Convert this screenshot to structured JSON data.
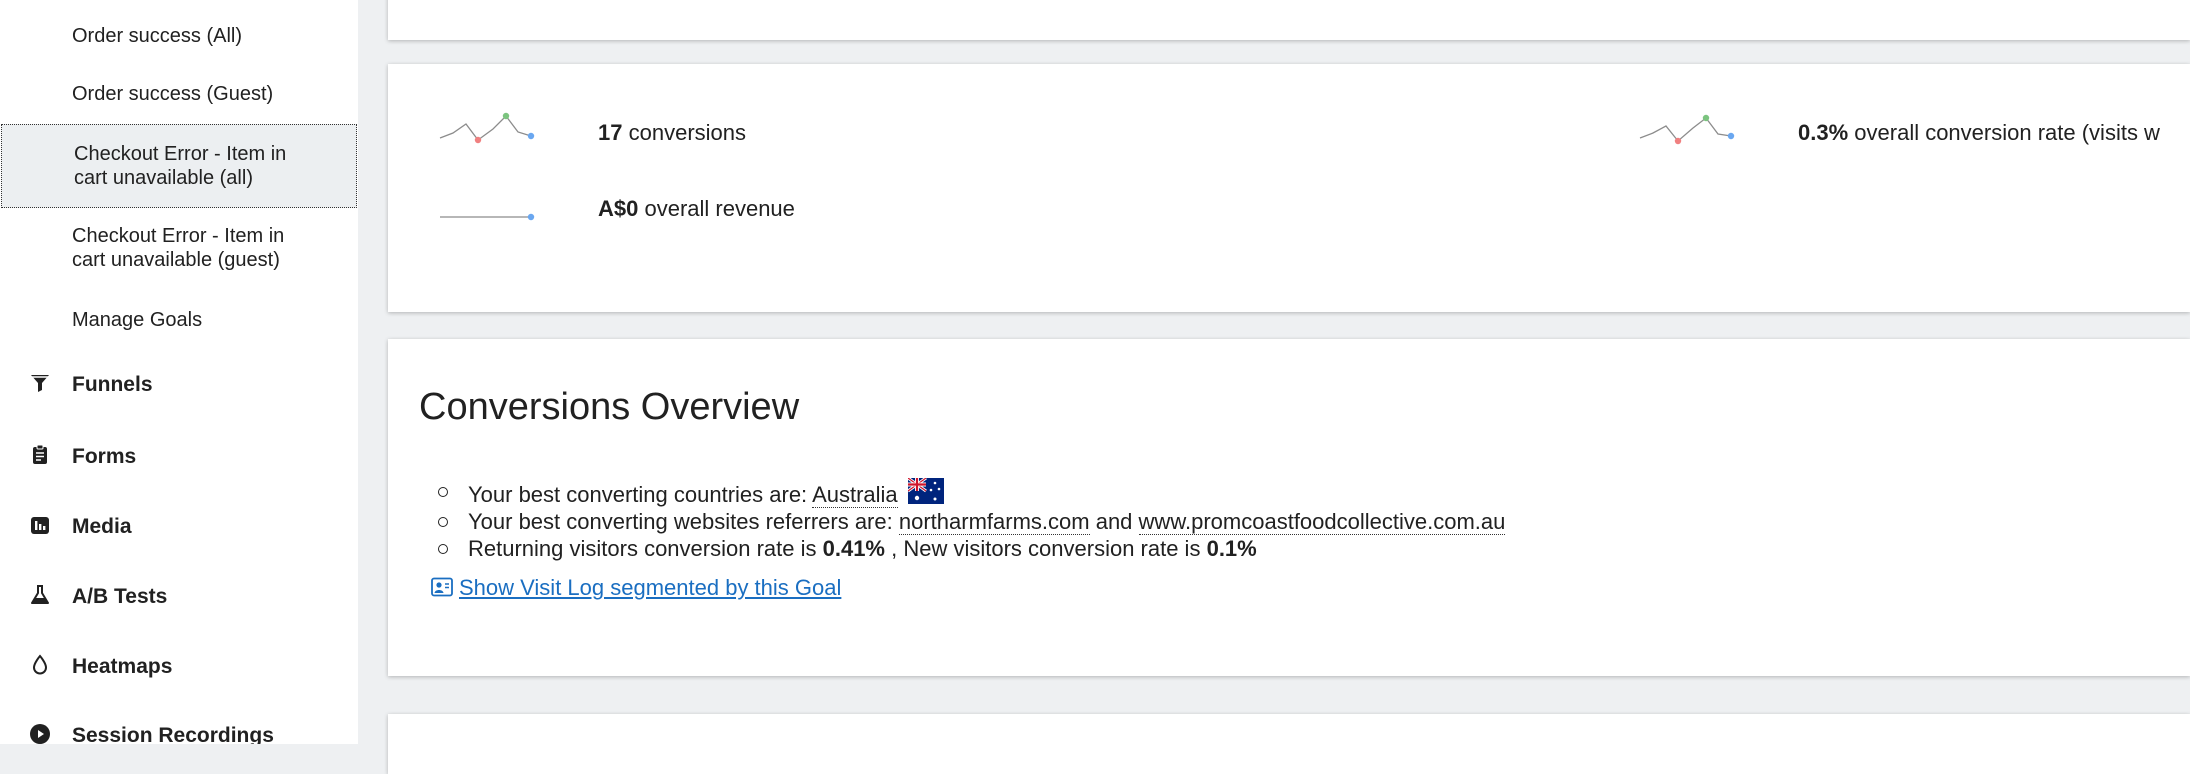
{
  "sidebar": {
    "goals": [
      {
        "label": "Order success (All)"
      },
      {
        "label": "Order success (Guest)"
      },
      {
        "label": "Checkout Error - Item in cart unavailable (all)",
        "line1": "Checkout Error - Item in",
        "line2": "cart unavailable (all)"
      },
      {
        "label": "Checkout Error - Item in cart unavailable (guest)",
        "line1": "Checkout Error - Item in",
        "line2": "cart unavailable (guest)"
      },
      {
        "label": "Manage Goals"
      }
    ],
    "categories": [
      {
        "label": "Funnels",
        "icon": "funnel-icon"
      },
      {
        "label": "Forms",
        "icon": "clipboard-icon"
      },
      {
        "label": "Media",
        "icon": "media-icon"
      },
      {
        "label": "A/B Tests",
        "icon": "flask-icon"
      },
      {
        "label": "Heatmaps",
        "icon": "drop-icon"
      },
      {
        "label": "Session Recordings",
        "icon": "play-icon"
      }
    ]
  },
  "metrics": {
    "conversions": {
      "value": "17",
      "label": "conversions"
    },
    "conversion_rate": {
      "value": "0.3%",
      "label": "overall conversion rate (visits w"
    },
    "revenue": {
      "value": "A$0",
      "label": "overall revenue"
    }
  },
  "overview": {
    "title": "Conversions Overview",
    "countries_prefix": "Your best converting countries are:",
    "country": "Australia",
    "referrers_prefix": "Your best converting websites referrers are:",
    "referrer1": "northarmfarms.com",
    "referrer_and": "and",
    "referrer2": "www.promcoastfoodcollective.com.au",
    "returning_prefix": "Returning visitors conversion rate is",
    "returning_rate": "0.41%",
    "new_prefix": ", New visitors conversion rate is",
    "new_rate": "0.1%",
    "visit_log_link": "Show Visit Log segmented by this Goal"
  },
  "colors": {
    "link": "#1a6ec1",
    "spark_line": "#8c8c8c",
    "spark_min": "#f08080",
    "spark_max": "#7bc47f",
    "spark_last": "#6aa7f0",
    "background": "#eef0f2"
  }
}
